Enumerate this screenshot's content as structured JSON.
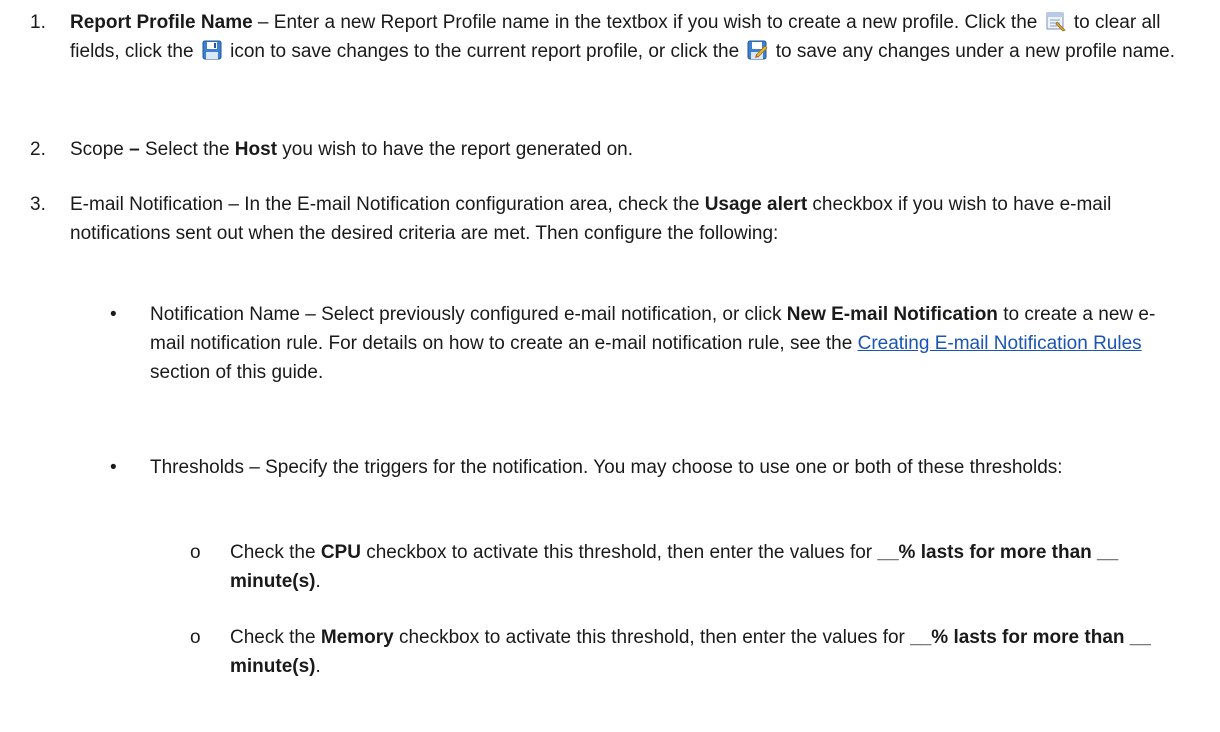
{
  "items": [
    {
      "number": "1.",
      "title": "Report Profile Name",
      "p1": " – Enter a new Report Profile name in the textbox if you wish to create a new profile. Click the ",
      "p2": " to clear all fields, click the ",
      "p3": " icon to save changes to the current report profile, or click the ",
      "p4": " to save any changes under a new profile name."
    },
    {
      "number": "2.",
      "lead": "Scope ",
      "dash": "–",
      "p1": " Select the ",
      "bold1": "Host",
      "p2": " you wish to have the report generated on."
    },
    {
      "number": "3.",
      "lead": "E-mail Notification – In the E-mail Notification configuration area, check the ",
      "bold1": "Usage alert",
      "p2": " checkbox if you wish to have e-mail notifications sent out when the desired criteria are met. Then configure the following:"
    }
  ],
  "bullets": [
    {
      "symbol": "•",
      "p1": "Notification Name – Select  previously configured e-mail notification, or click ",
      "bold1": "New E-mail Notification",
      "p2": " to create a new e-mail notification rule. For details on how to create an e-mail notification rule, see the ",
      "link": "Creating E-mail Notification Rules",
      "p3": " section of this guide."
    },
    {
      "symbol": "•",
      "p1": "Thresholds – Specify the triggers for the notification. You may choose to use one or both of these thresholds:"
    }
  ],
  "sub_bullets": [
    {
      "symbol": "o",
      "p1": "Check the ",
      "bold1": "CPU",
      "p2": " checkbox to activate this threshold, then enter the values for ",
      "bold2": "__% lasts for more than __ minute(s)",
      "p3": "."
    },
    {
      "symbol": "o",
      "p1": "Check the ",
      "bold1": "Memory",
      "p2": " checkbox to activate this threshold, then enter the values for ",
      "bold2": "__% lasts for more than __ minute(s)",
      "p3": "."
    }
  ],
  "icons": {
    "clear": "clear-fields-icon",
    "save": "save-icon",
    "save_as": "save-as-icon"
  }
}
